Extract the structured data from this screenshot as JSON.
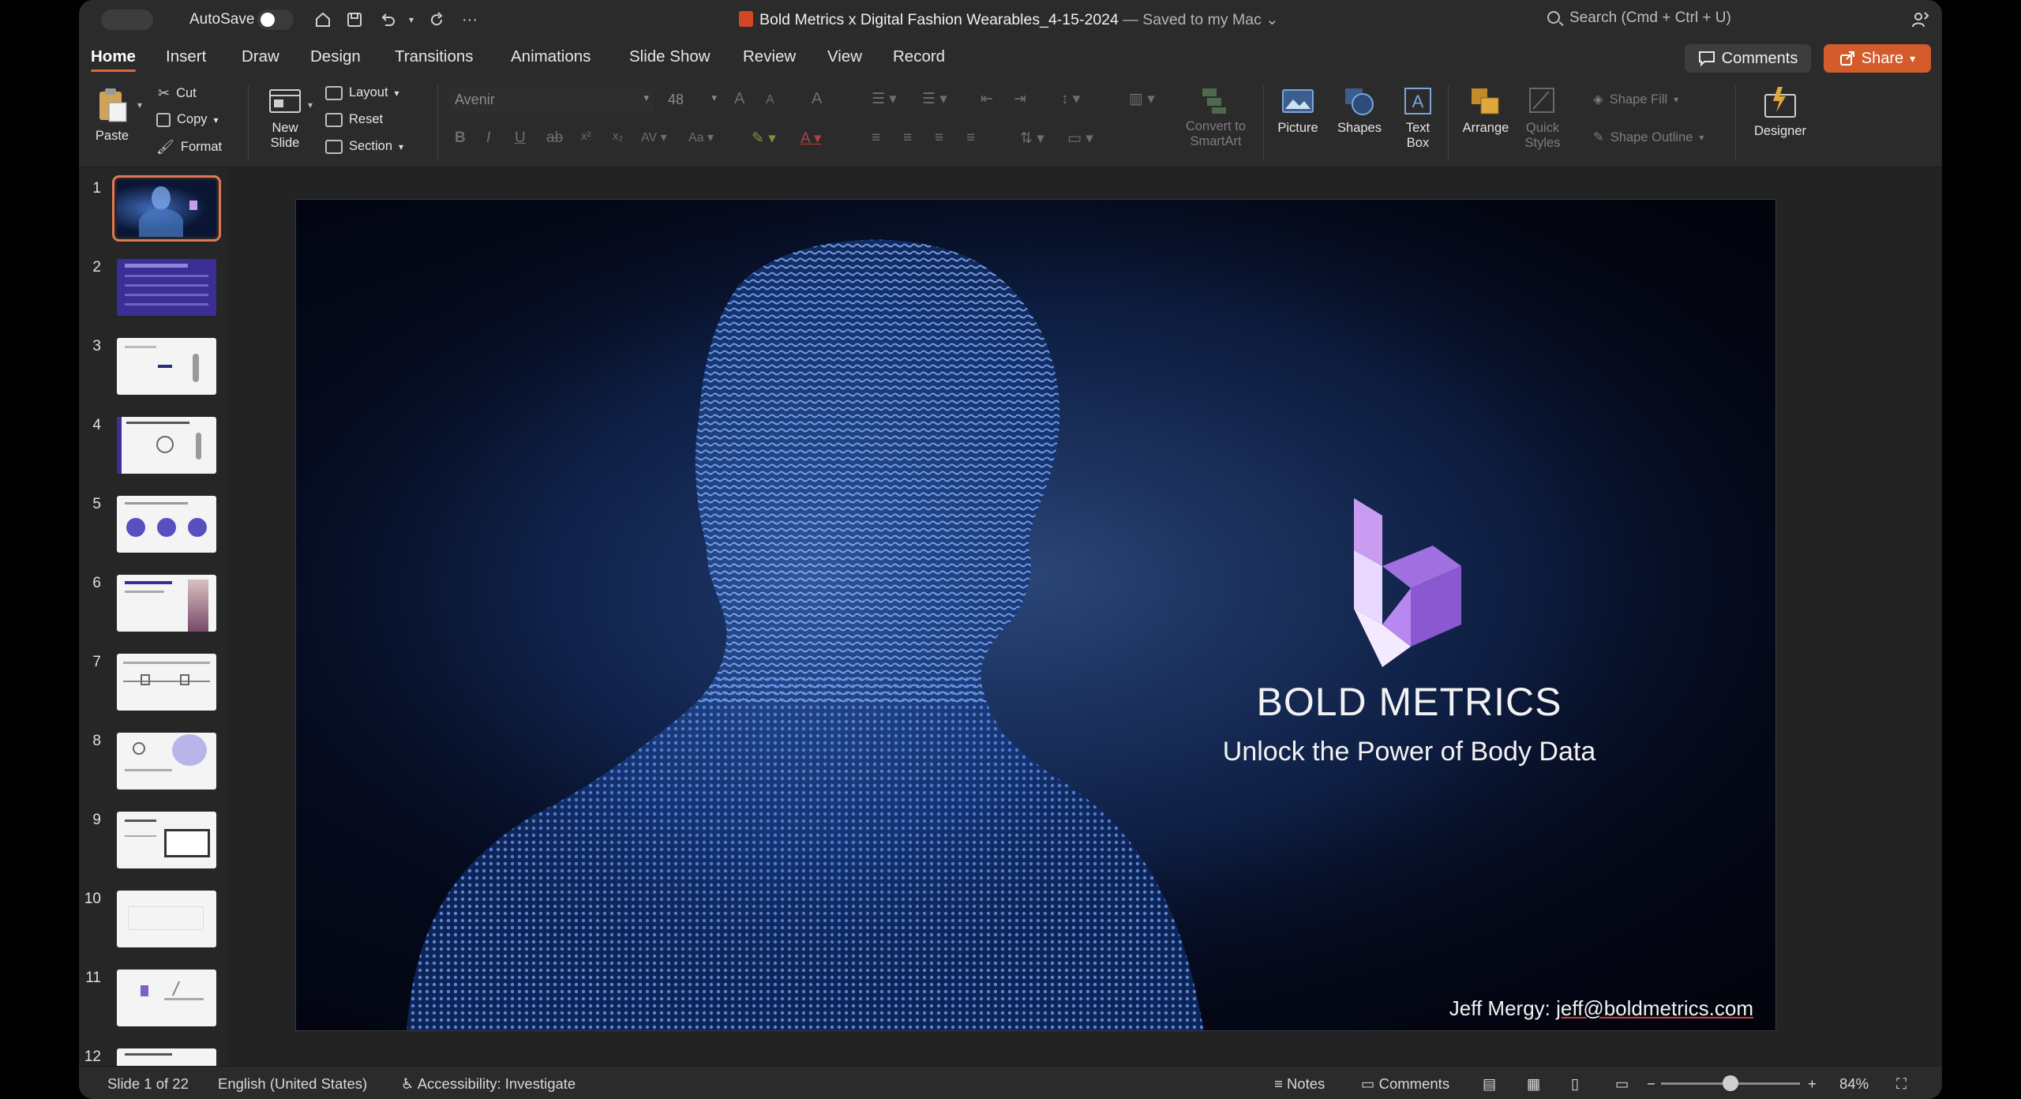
{
  "titlebar": {
    "autosave_label": "AutoSave",
    "document_title": "Bold Metrics x Digital Fashion Wearables_4-15-2024",
    "save_status": "— Saved to my Mac",
    "search_placeholder": "Search (Cmd + Ctrl + U)"
  },
  "tabs": [
    {
      "label": "Home",
      "active": true
    },
    {
      "label": "Insert"
    },
    {
      "label": "Draw"
    },
    {
      "label": "Design"
    },
    {
      "label": "Transitions"
    },
    {
      "label": "Animations"
    },
    {
      "label": "Slide Show"
    },
    {
      "label": "Review"
    },
    {
      "label": "View"
    },
    {
      "label": "Record"
    }
  ],
  "header_buttons": {
    "comments": "Comments",
    "share": "Share"
  },
  "ribbon": {
    "paste": "Paste",
    "cut": "Cut",
    "copy": "Copy",
    "format": "Format",
    "new_slide_line1": "New",
    "new_slide_line2": "Slide",
    "layout": "Layout",
    "reset": "Reset",
    "section": "Section",
    "font_name": "Avenir",
    "font_size": "48",
    "convert_line1": "Convert to",
    "convert_line2": "SmartArt",
    "picture": "Picture",
    "shapes": "Shapes",
    "textbox_line1": "Text",
    "textbox_line2": "Box",
    "arrange": "Arrange",
    "quick_styles_line1": "Quick",
    "quick_styles_line2": "Styles",
    "shape_fill": "Shape Fill",
    "shape_outline": "Shape Outline",
    "designer": "Designer"
  },
  "thumbnails": [
    "1",
    "2",
    "3",
    "4",
    "5",
    "6",
    "7",
    "8",
    "9",
    "10",
    "11",
    "12"
  ],
  "slide": {
    "brand_name": "BOLD METRICS",
    "tagline": "Unlock the Power of Body Data",
    "contact_name": "Jeff Mergy:",
    "contact_email": "jeff@boldmetrics.com"
  },
  "statusbar": {
    "slide_position": "Slide 1 of 22",
    "language": "English (United States)",
    "accessibility": "Accessibility: Investigate",
    "notes": "Notes",
    "comments": "Comments",
    "zoom": "84%"
  },
  "colors": {
    "accent": "#d86a3c",
    "share_button": "#d35b2c",
    "logo_purple": "#a070e0",
    "slide_bg": "#050a1c"
  }
}
